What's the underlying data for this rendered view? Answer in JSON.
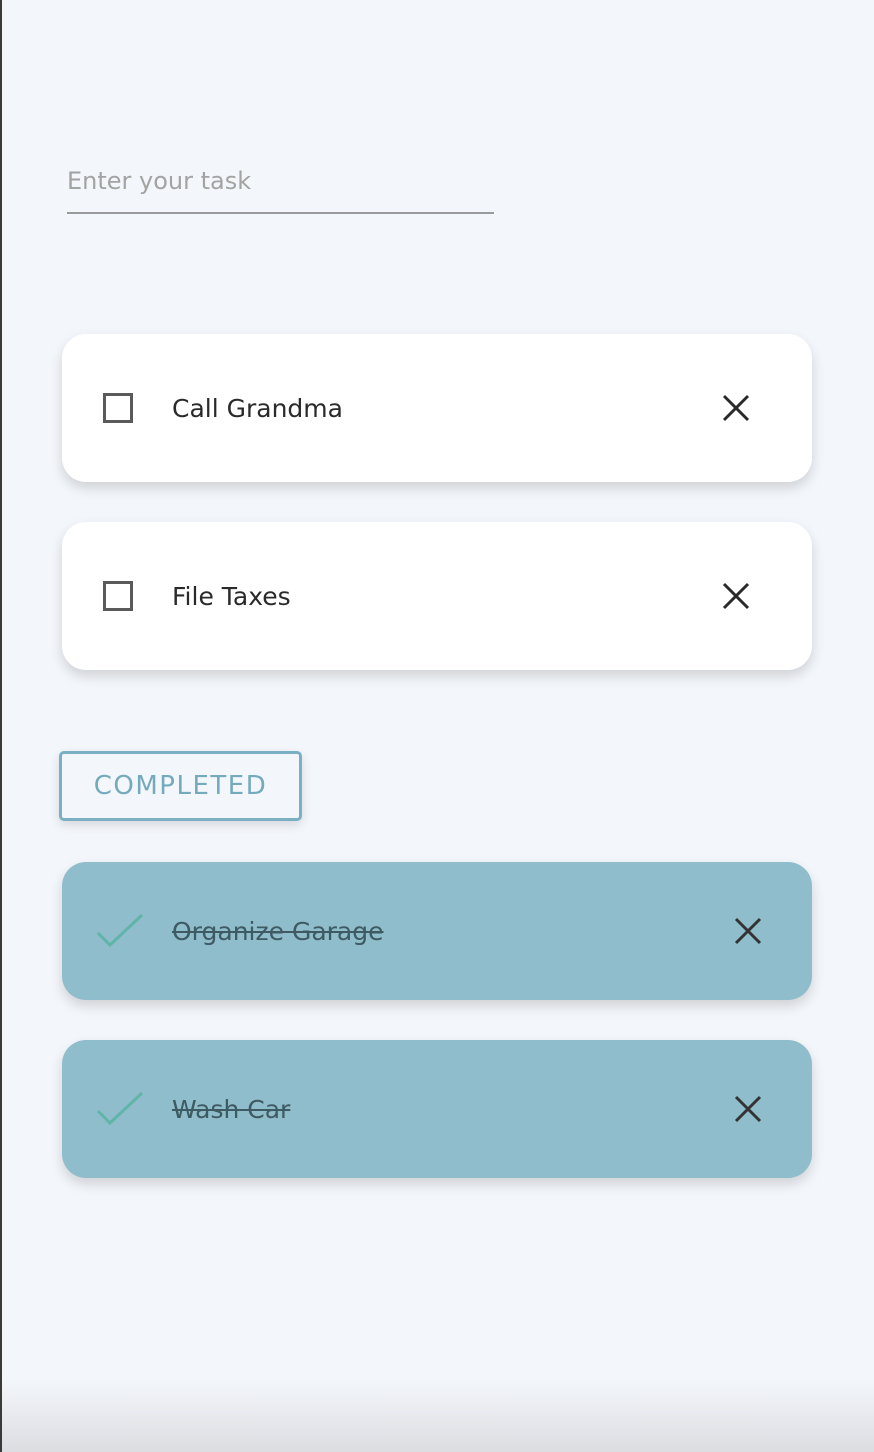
{
  "input": {
    "placeholder": "Enter your task",
    "value": ""
  },
  "tasks": [
    {
      "label": "Call Grandma",
      "completed": false
    },
    {
      "label": "File Taxes",
      "completed": false
    }
  ],
  "completed_toggle": {
    "label": "COMPLETED",
    "color": "#74abbc"
  },
  "completed_tasks": [
    {
      "label": "Organize Garage",
      "completed": true
    },
    {
      "label": "Wash Car",
      "completed": true
    }
  ],
  "colors": {
    "completed_card": "#8fbdcb",
    "check": "#5fb5a7",
    "background": "#f3f6fb"
  }
}
